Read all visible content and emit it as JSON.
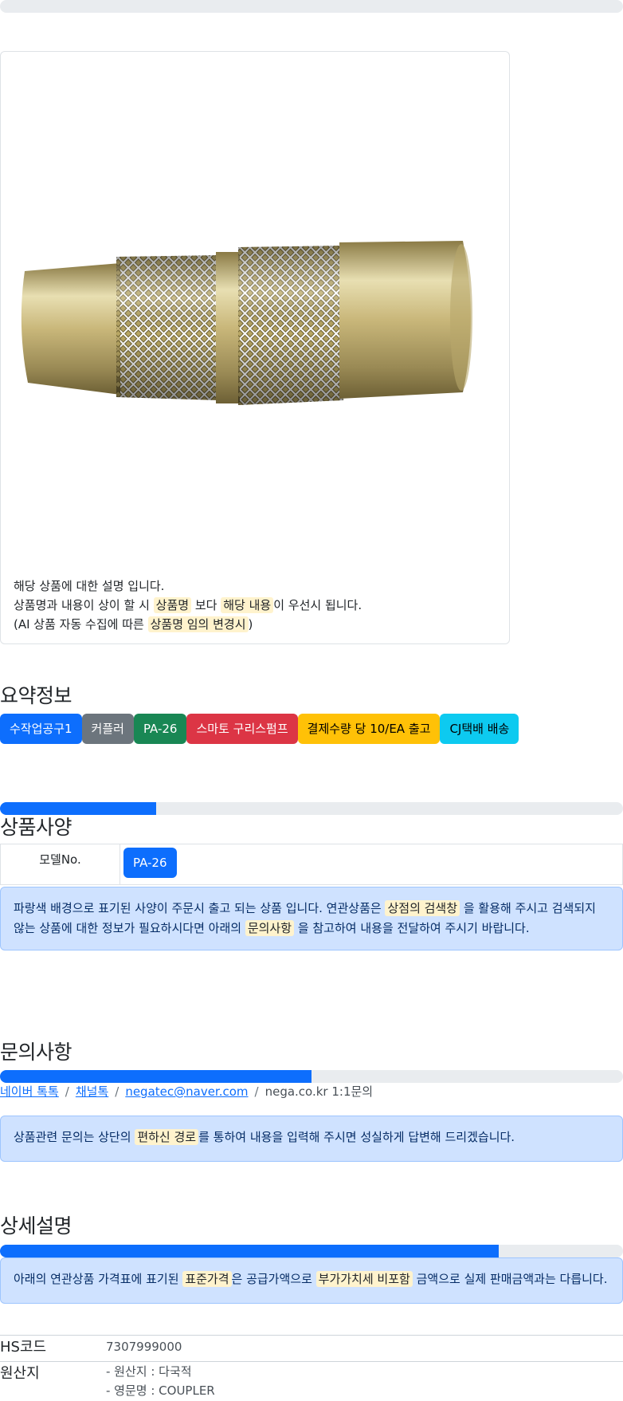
{
  "top_progress": {
    "value": 0
  },
  "product_card": {
    "image_icon": "grease-coupler-image",
    "line1": "해당 상품에 대한 설명 입니다.",
    "line2_a": "상품명과 내용이 상이 할 시",
    "line2_hl1": "상품명",
    "line2_b": "보다",
    "line2_hl2": "해당 내용",
    "line2_c": "이 우선시 됩니다.",
    "line3_a": "(AI 상품 자동 수집에 따른",
    "line3_hl": "상품명 임의 변경시",
    "line3_b": ")"
  },
  "summary": {
    "title": "요약정보",
    "badges": [
      {
        "label": "수작업공구1",
        "color": "#0d6efd"
      },
      {
        "label": "커플러",
        "color": "#6c757d"
      },
      {
        "label": "PA-26",
        "color": "#198754"
      },
      {
        "label": "스마토 구리스펌프",
        "color": "#dc3545"
      },
      {
        "label": "결제수량 당 10/EA 출고",
        "color": "#ffc107"
      },
      {
        "label": "CJ택배 배송",
        "color": "#0dcaf0"
      }
    ]
  },
  "spec": {
    "progress": 0.25,
    "title": "상품사양",
    "model_label": "모델No.",
    "model_value": "PA-26",
    "notice_a": "파랑색 배경으로 표기된 사양이 주문시 출고 되는 상품 입니다. 연관상품은",
    "notice_hl1": "상점의 검색창",
    "notice_b": "을 활용해 주시고 검색되지 않는 상품에 대한 정보가 필요하시다면 아래의",
    "notice_hl2": "문의사항",
    "notice_c": "을 참고하여 내용을 전달하여 주시기 바랍니다."
  },
  "inquiry": {
    "title": "문의사항",
    "progress": 0.5,
    "links": [
      "네이버 톡톡",
      "채널톡",
      "negatec@naver.com"
    ],
    "plain": "nega.co.kr 1:1문의",
    "notice_a": "상품관련 문의는 상단의",
    "notice_hl": "편하신 경로",
    "notice_b": "를 통하여 내용을 입력해 주시면 성실하게 답변해 드리겠습니다."
  },
  "detail": {
    "title": "상세설명",
    "progress": 0.8,
    "notice_a": "아래의 연관상품 가격표에 표기된",
    "notice_hl1": "표준가격",
    "notice_b": "은 공급가액으로",
    "notice_hl2": "부가가치세 비포함",
    "notice_c": "금액으로 실제 판매금액과는 다릅니다.",
    "rows": [
      {
        "key": "HS코드",
        "value": "7307999000"
      },
      {
        "key": "원산지",
        "value1": "- 원산지 : 다국적",
        "value2": "- 영문명 : COUPLER"
      }
    ]
  }
}
